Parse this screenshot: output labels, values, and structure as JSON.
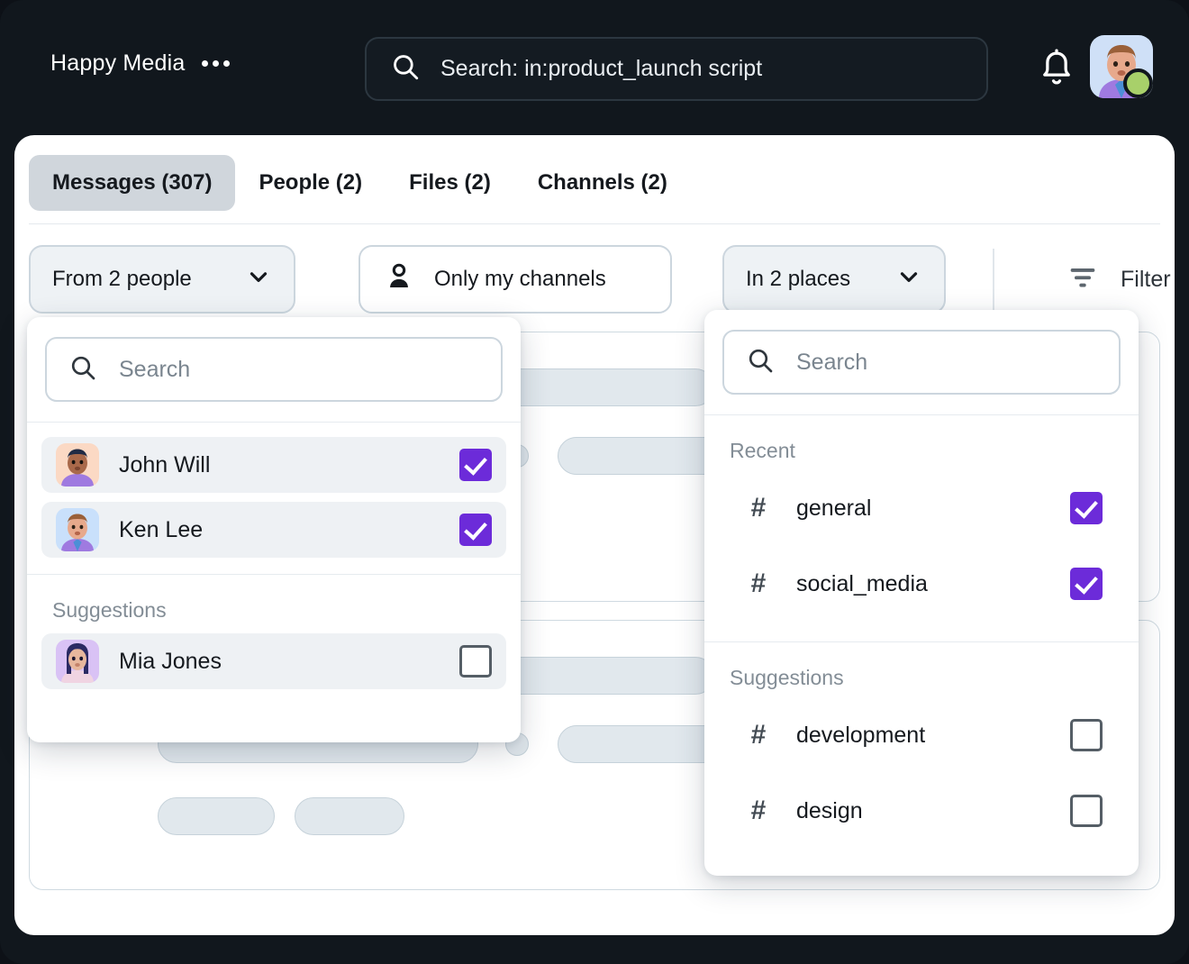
{
  "header": {
    "brand": "Happy Media",
    "menu_icon": "ellipsis-icon",
    "search": {
      "icon": "search-icon",
      "value": "Search: in:product_launch script",
      "placeholder": "Search"
    },
    "bell_icon": "bell-icon",
    "avatar_icon": "user-avatar",
    "status": "online",
    "status_color": "#a8d06a"
  },
  "tabs": [
    {
      "label": "Messages (307)",
      "active": true
    },
    {
      "label": "People (2)",
      "active": false
    },
    {
      "label": "Files (2)",
      "active": false
    },
    {
      "label": "Channels (2)",
      "active": false
    }
  ],
  "filters": {
    "people_chip": {
      "label": "From 2 people",
      "icon": "chevron-down-icon",
      "active": true
    },
    "my_channels_chip": {
      "label": "Only my channels",
      "icon": "person-icon",
      "active": false
    },
    "places_chip": {
      "label": "In 2 places",
      "icon": "chevron-down-icon",
      "active": true
    },
    "filter_button": {
      "label": "Filter",
      "icon": "filter-icon"
    }
  },
  "people_dropdown": {
    "search_placeholder": "Search",
    "search_icon": "search-icon",
    "selected": [
      {
        "name": "John Will",
        "checked": true,
        "avatar": "avatar-john"
      },
      {
        "name": "Ken Lee",
        "checked": true,
        "avatar": "avatar-ken"
      }
    ],
    "suggestions_label": "Suggestions",
    "suggestions": [
      {
        "name": "Mia Jones",
        "checked": false,
        "avatar": "avatar-mia"
      }
    ]
  },
  "channels_dropdown": {
    "search_placeholder": "Search",
    "search_icon": "search-icon",
    "recent_label": "Recent",
    "recent": [
      {
        "name": "general",
        "checked": true,
        "icon": "hash-icon"
      },
      {
        "name": "social_media",
        "checked": true,
        "icon": "hash-icon"
      }
    ],
    "suggestions_label": "Suggestions",
    "suggestions": [
      {
        "name": "development",
        "checked": false,
        "icon": "hash-icon"
      },
      {
        "name": "design",
        "checked": false,
        "icon": "hash-icon"
      }
    ]
  },
  "theme": {
    "accent_purple": "#6C2BD9",
    "header_bg": "#11171d",
    "panel_bg": "#ffffff",
    "chip_active_bg": "#eef2f5",
    "skeleton_fill": "#e1e8ed"
  }
}
